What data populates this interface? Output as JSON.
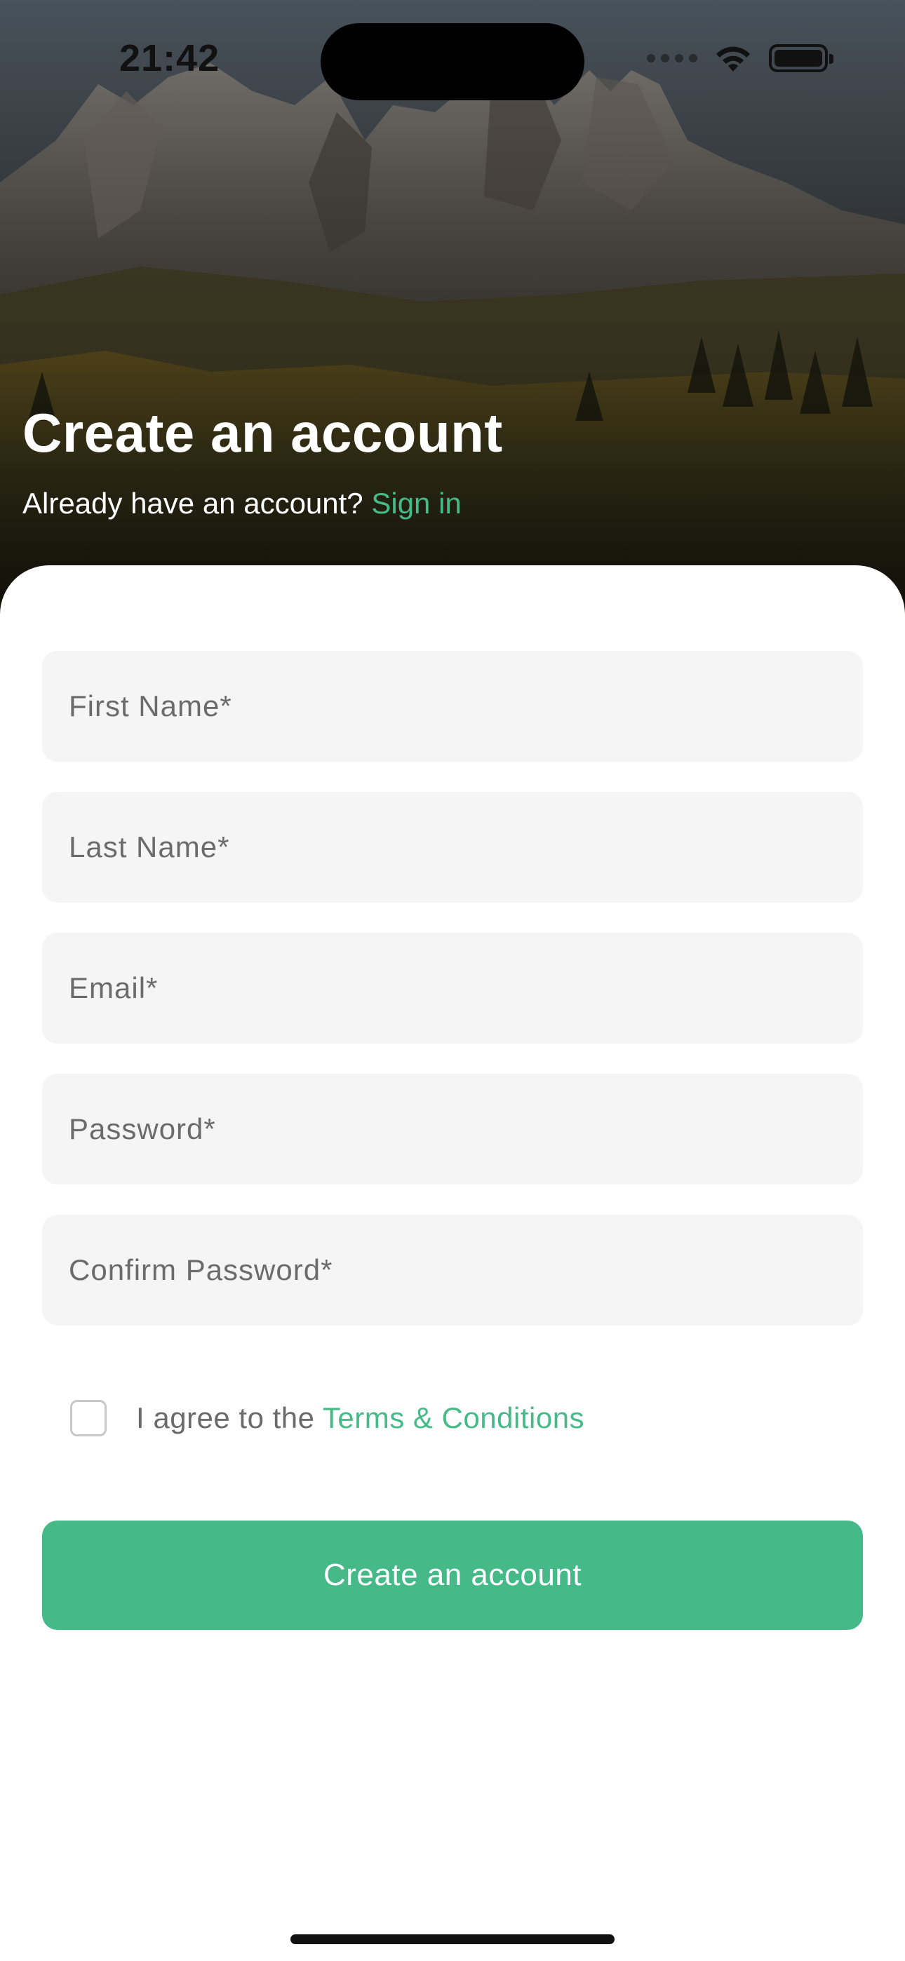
{
  "status_bar": {
    "time": "21:42"
  },
  "header": {
    "title": "Create an account",
    "subtitle_prefix": "Already have an account? ",
    "signin_link": "Sign in"
  },
  "form": {
    "first_name_placeholder": "First Name*",
    "last_name_placeholder": "Last Name*",
    "email_placeholder": "Email*",
    "password_placeholder": "Password*",
    "confirm_password_placeholder": "Confirm Password*",
    "terms_checked": false,
    "terms_prefix": "I agree to the ",
    "terms_link": "Terms & Conditions",
    "submit_label": "Create an account"
  },
  "colors": {
    "accent": "#46bb87",
    "button": "#45ba88",
    "field_bg": "#f5f5f5",
    "placeholder": "#6b6b6b"
  },
  "icons": {
    "wifi": "wifi-icon",
    "battery": "battery-icon",
    "signal": "cellular-signal-icon"
  }
}
